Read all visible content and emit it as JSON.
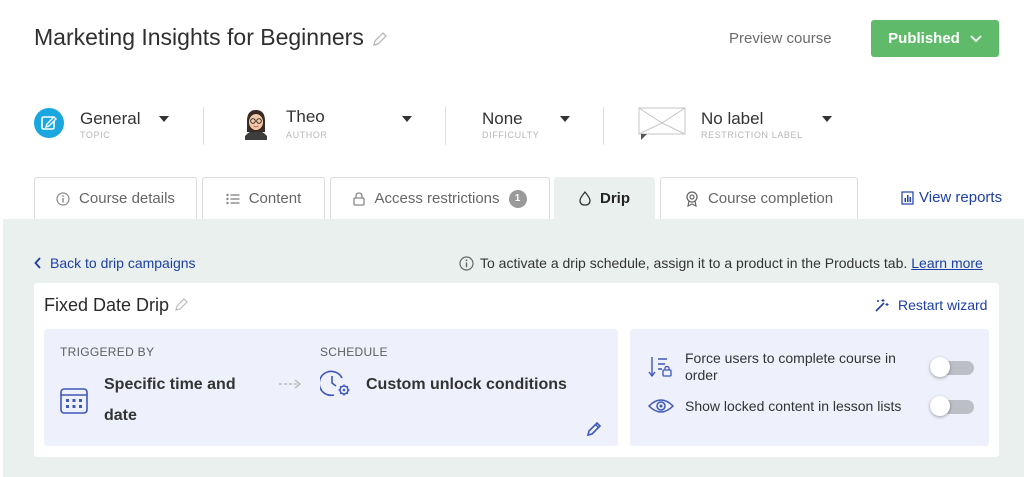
{
  "header": {
    "title": "Marketing Insights for Beginners",
    "preview_label": "Preview course",
    "publish_label": "Published"
  },
  "meta": {
    "topic": {
      "value": "General",
      "label": "TOPIC"
    },
    "author": {
      "value": "Theo",
      "label": "AUTHOR"
    },
    "difficulty": {
      "value": "None",
      "label": "DIFFICULTY"
    },
    "restriction": {
      "value": "No label",
      "label": "RESTRICTION LABEL"
    }
  },
  "tabs": [
    {
      "label": "Course details",
      "icon": "info-icon"
    },
    {
      "label": "Content",
      "icon": "list-icon"
    },
    {
      "label": "Access restrictions",
      "icon": "lock-icon",
      "badge": "1"
    },
    {
      "label": "Drip",
      "icon": "drop-icon",
      "active": true
    },
    {
      "label": "Course completion",
      "icon": "medal-icon"
    }
  ],
  "view_reports": "View reports",
  "drip": {
    "back_label": "Back to drip campaigns",
    "info_text": "To activate a drip schedule, assign it to a product in the Products tab.",
    "learn_more": "Learn more",
    "card_title": "Fixed Date Drip",
    "restart_label": "Restart wizard",
    "triggered_by_label": "TRIGGERED BY",
    "triggered_by_value_line1": "Specific time and",
    "triggered_by_value_line2": "date",
    "schedule_label": "SCHEDULE",
    "schedule_value": "Custom unlock conditions",
    "options": [
      {
        "label_line1": "Force users to complete course in",
        "label_line2": "order",
        "enabled": false
      },
      {
        "label_line1": "Show locked content in lesson lists",
        "enabled": false
      }
    ]
  },
  "colors": {
    "accent_blue": "#1d3ea6",
    "publish_green": "#5fbb6a",
    "topic_icon_bg": "#1aa7e0",
    "panel_bg": "#eaf0ee",
    "box_bg": "#eef0fb"
  }
}
